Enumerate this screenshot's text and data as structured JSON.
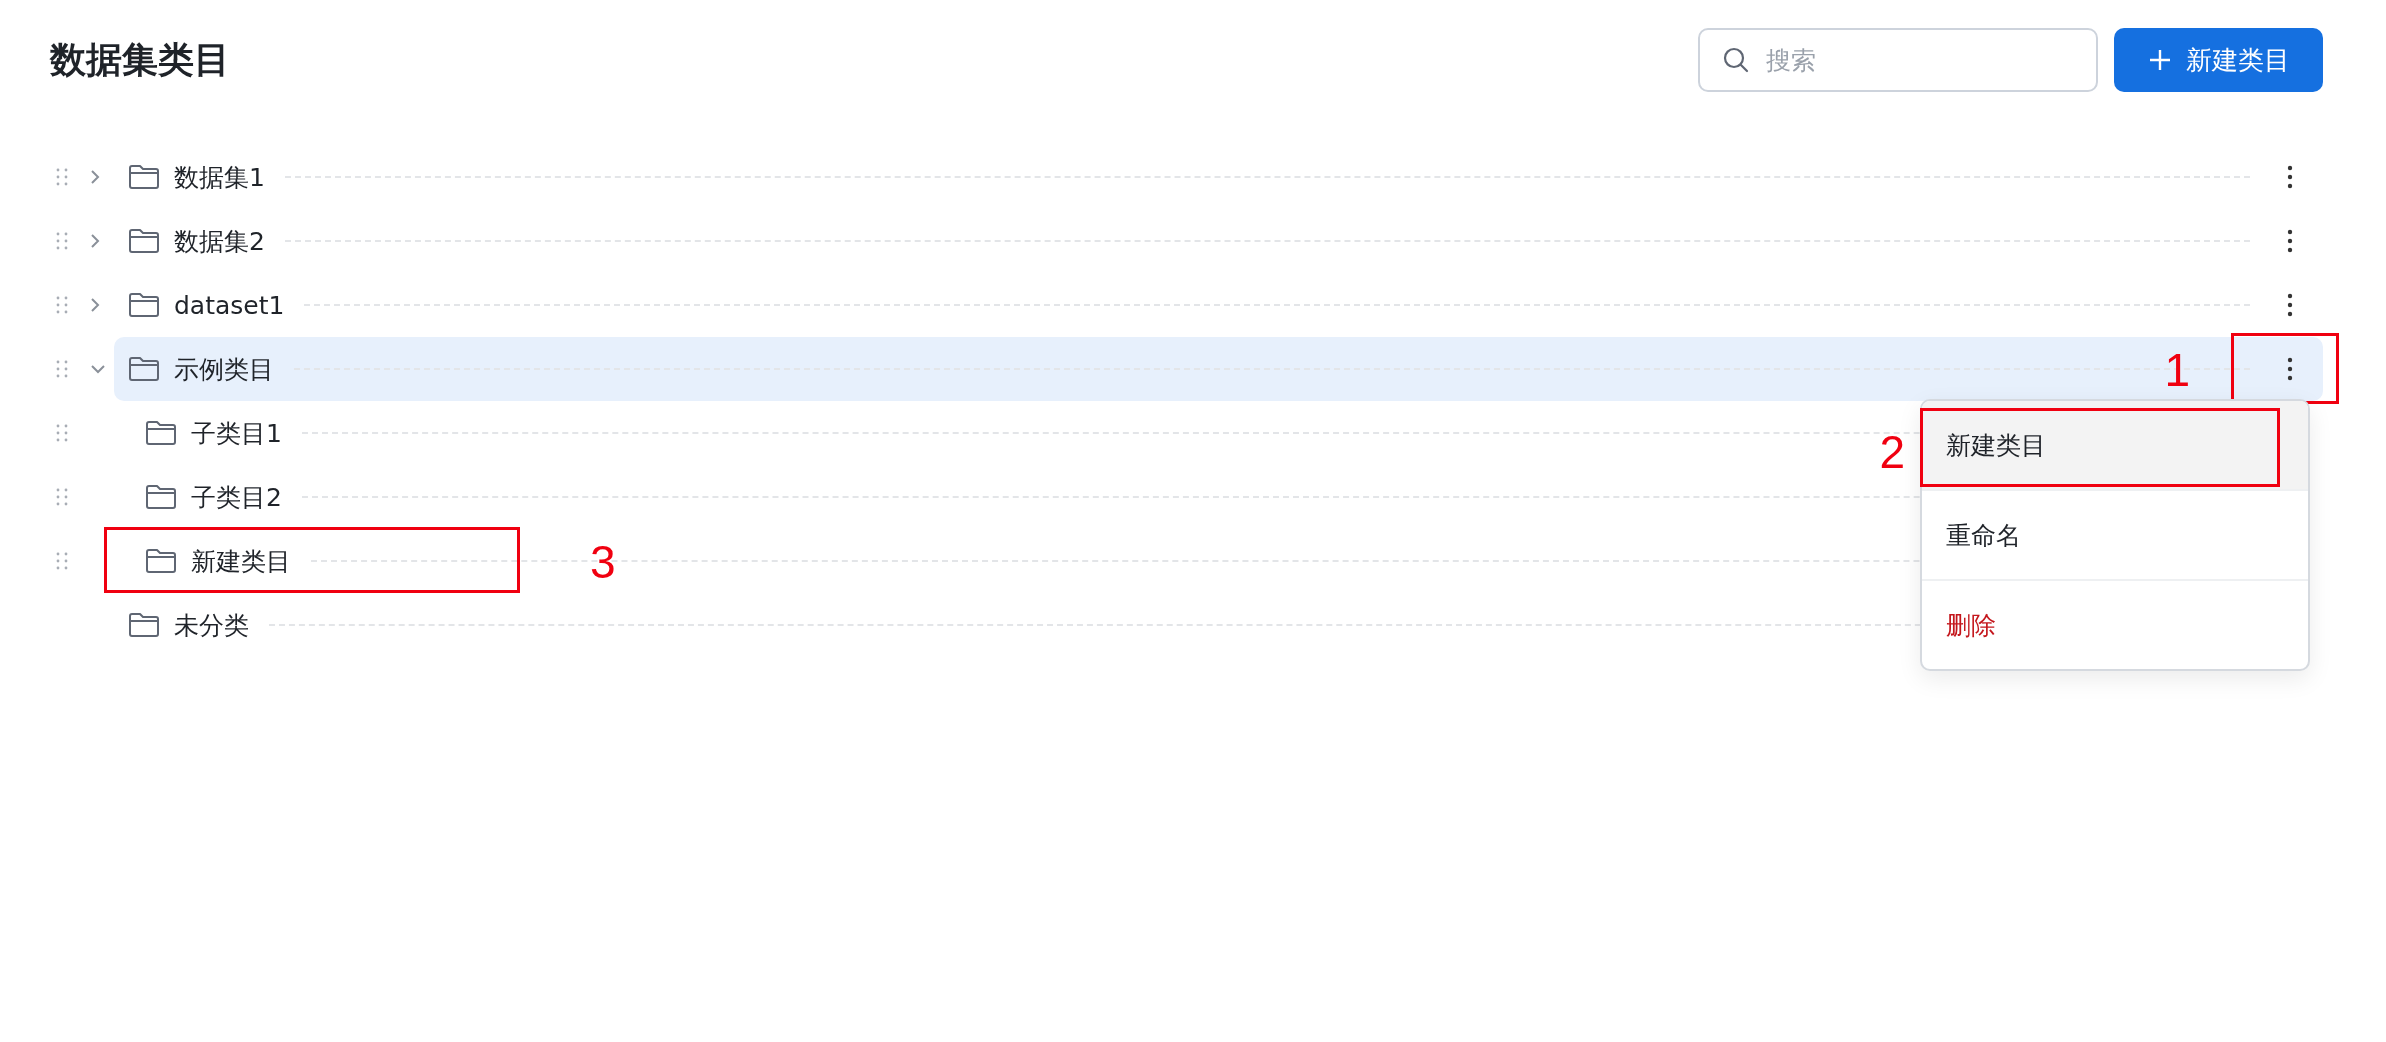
{
  "title": "数据集类目",
  "search": {
    "placeholder": "搜索"
  },
  "new_button": {
    "label": "新建类目"
  },
  "tree": [
    {
      "label": "数据集1",
      "draggable": true,
      "expanded": false,
      "selected": false,
      "more_button": true
    },
    {
      "label": "数据集2",
      "draggable": true,
      "expanded": false,
      "selected": false,
      "more_button": true
    },
    {
      "label": "dataset1",
      "draggable": true,
      "expanded": false,
      "selected": false,
      "more_button": true
    },
    {
      "label": "示例类目",
      "draggable": true,
      "expanded": true,
      "selected": true,
      "more_button": true,
      "more_annotation": "1",
      "children": [
        {
          "label": "子类目1",
          "draggable": true,
          "selected": false
        },
        {
          "label": "子类目2",
          "draggable": true,
          "selected": false
        },
        {
          "label": "新建类目",
          "draggable": true,
          "selected": false,
          "annotation": "3"
        }
      ]
    },
    {
      "label": "未分类",
      "draggable": false,
      "selected": false
    }
  ],
  "context_menu": {
    "items": [
      {
        "label": "新建类目",
        "kind": "normal",
        "highlighted": true,
        "annotation": "2"
      },
      {
        "label": "重命名",
        "kind": "normal",
        "highlighted": false
      },
      {
        "label": "删除",
        "kind": "danger",
        "highlighted": false
      }
    ]
  }
}
